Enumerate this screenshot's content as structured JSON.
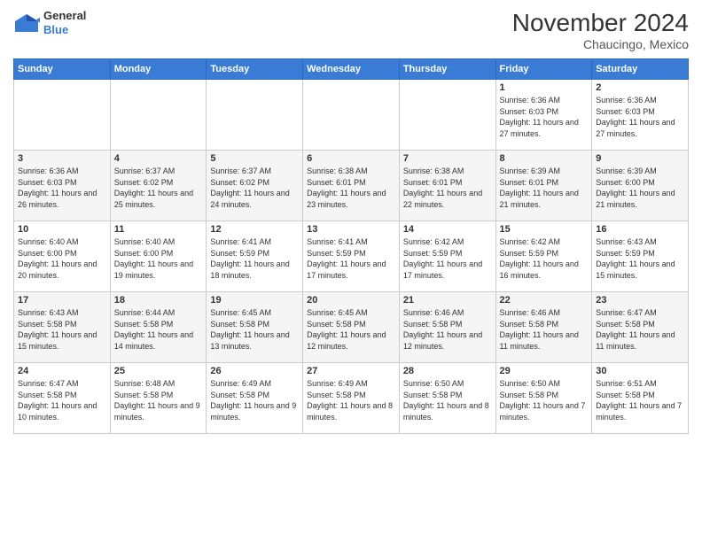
{
  "header": {
    "logo_general": "General",
    "logo_blue": "Blue",
    "month": "November 2024",
    "location": "Chaucingo, Mexico"
  },
  "days_of_week": [
    "Sunday",
    "Monday",
    "Tuesday",
    "Wednesday",
    "Thursday",
    "Friday",
    "Saturday"
  ],
  "weeks": [
    [
      {
        "day": "",
        "info": ""
      },
      {
        "day": "",
        "info": ""
      },
      {
        "day": "",
        "info": ""
      },
      {
        "day": "",
        "info": ""
      },
      {
        "day": "",
        "info": ""
      },
      {
        "day": "1",
        "info": "Sunrise: 6:36 AM\nSunset: 6:03 PM\nDaylight: 11 hours and 27 minutes."
      },
      {
        "day": "2",
        "info": "Sunrise: 6:36 AM\nSunset: 6:03 PM\nDaylight: 11 hours and 27 minutes."
      }
    ],
    [
      {
        "day": "3",
        "info": "Sunrise: 6:36 AM\nSunset: 6:03 PM\nDaylight: 11 hours and 26 minutes."
      },
      {
        "day": "4",
        "info": "Sunrise: 6:37 AM\nSunset: 6:02 PM\nDaylight: 11 hours and 25 minutes."
      },
      {
        "day": "5",
        "info": "Sunrise: 6:37 AM\nSunset: 6:02 PM\nDaylight: 11 hours and 24 minutes."
      },
      {
        "day": "6",
        "info": "Sunrise: 6:38 AM\nSunset: 6:01 PM\nDaylight: 11 hours and 23 minutes."
      },
      {
        "day": "7",
        "info": "Sunrise: 6:38 AM\nSunset: 6:01 PM\nDaylight: 11 hours and 22 minutes."
      },
      {
        "day": "8",
        "info": "Sunrise: 6:39 AM\nSunset: 6:01 PM\nDaylight: 11 hours and 21 minutes."
      },
      {
        "day": "9",
        "info": "Sunrise: 6:39 AM\nSunset: 6:00 PM\nDaylight: 11 hours and 21 minutes."
      }
    ],
    [
      {
        "day": "10",
        "info": "Sunrise: 6:40 AM\nSunset: 6:00 PM\nDaylight: 11 hours and 20 minutes."
      },
      {
        "day": "11",
        "info": "Sunrise: 6:40 AM\nSunset: 6:00 PM\nDaylight: 11 hours and 19 minutes."
      },
      {
        "day": "12",
        "info": "Sunrise: 6:41 AM\nSunset: 5:59 PM\nDaylight: 11 hours and 18 minutes."
      },
      {
        "day": "13",
        "info": "Sunrise: 6:41 AM\nSunset: 5:59 PM\nDaylight: 11 hours and 17 minutes."
      },
      {
        "day": "14",
        "info": "Sunrise: 6:42 AM\nSunset: 5:59 PM\nDaylight: 11 hours and 17 minutes."
      },
      {
        "day": "15",
        "info": "Sunrise: 6:42 AM\nSunset: 5:59 PM\nDaylight: 11 hours and 16 minutes."
      },
      {
        "day": "16",
        "info": "Sunrise: 6:43 AM\nSunset: 5:59 PM\nDaylight: 11 hours and 15 minutes."
      }
    ],
    [
      {
        "day": "17",
        "info": "Sunrise: 6:43 AM\nSunset: 5:58 PM\nDaylight: 11 hours and 15 minutes."
      },
      {
        "day": "18",
        "info": "Sunrise: 6:44 AM\nSunset: 5:58 PM\nDaylight: 11 hours and 14 minutes."
      },
      {
        "day": "19",
        "info": "Sunrise: 6:45 AM\nSunset: 5:58 PM\nDaylight: 11 hours and 13 minutes."
      },
      {
        "day": "20",
        "info": "Sunrise: 6:45 AM\nSunset: 5:58 PM\nDaylight: 11 hours and 12 minutes."
      },
      {
        "day": "21",
        "info": "Sunrise: 6:46 AM\nSunset: 5:58 PM\nDaylight: 11 hours and 12 minutes."
      },
      {
        "day": "22",
        "info": "Sunrise: 6:46 AM\nSunset: 5:58 PM\nDaylight: 11 hours and 11 minutes."
      },
      {
        "day": "23",
        "info": "Sunrise: 6:47 AM\nSunset: 5:58 PM\nDaylight: 11 hours and 11 minutes."
      }
    ],
    [
      {
        "day": "24",
        "info": "Sunrise: 6:47 AM\nSunset: 5:58 PM\nDaylight: 11 hours and 10 minutes."
      },
      {
        "day": "25",
        "info": "Sunrise: 6:48 AM\nSunset: 5:58 PM\nDaylight: 11 hours and 9 minutes."
      },
      {
        "day": "26",
        "info": "Sunrise: 6:49 AM\nSunset: 5:58 PM\nDaylight: 11 hours and 9 minutes."
      },
      {
        "day": "27",
        "info": "Sunrise: 6:49 AM\nSunset: 5:58 PM\nDaylight: 11 hours and 8 minutes."
      },
      {
        "day": "28",
        "info": "Sunrise: 6:50 AM\nSunset: 5:58 PM\nDaylight: 11 hours and 8 minutes."
      },
      {
        "day": "29",
        "info": "Sunrise: 6:50 AM\nSunset: 5:58 PM\nDaylight: 11 hours and 7 minutes."
      },
      {
        "day": "30",
        "info": "Sunrise: 6:51 AM\nSunset: 5:58 PM\nDaylight: 11 hours and 7 minutes."
      }
    ]
  ]
}
